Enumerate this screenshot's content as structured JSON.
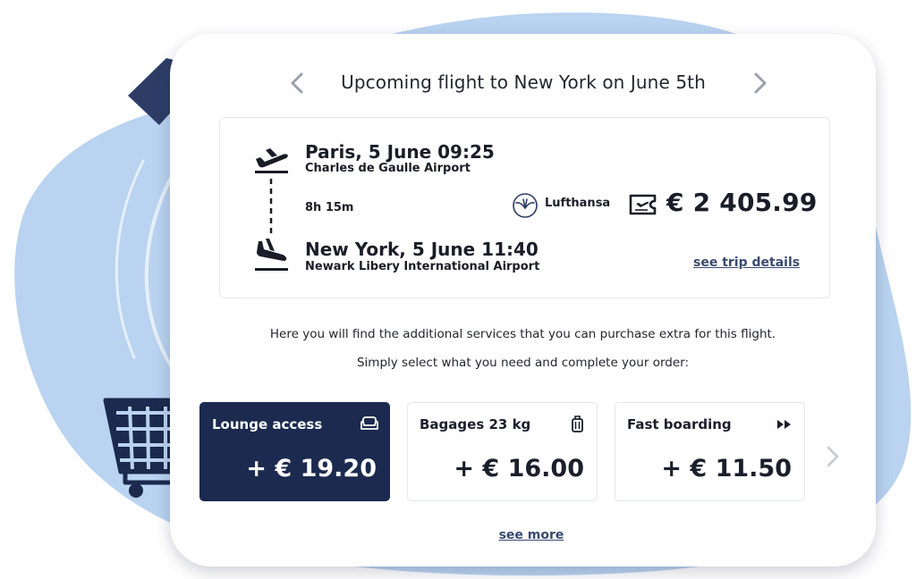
{
  "header": {
    "title": "Upcoming flight to New York on June 5th"
  },
  "flight": {
    "departure": {
      "city_time": "Paris, 5 June 09:25",
      "airport": "Charles de Gaulle Airport"
    },
    "arrival": {
      "city_time": "New York, 5 June 11:40",
      "airport": "Newark Libery International Airport"
    },
    "duration": "8h 15m",
    "airline": "Lufthansa",
    "price": "€ 2 405.99",
    "trip_details_link": "see trip details"
  },
  "info": {
    "line1": "Here you will find the additional services that you can purchase extra for this flight.",
    "line2": "Simply select what you need and complete your order:"
  },
  "services": [
    {
      "label": "Lounge access",
      "price": "+ € 19.20",
      "icon": "sofa-icon",
      "selected": true
    },
    {
      "label": "Bagages 23 kg",
      "price": "+ € 16.00",
      "icon": "suitcase-icon",
      "selected": false
    },
    {
      "label": "Fast boarding",
      "price": "+ € 11.50",
      "icon": "fast-forward-icon",
      "selected": false
    }
  ],
  "footer": {
    "see_more": "see more"
  },
  "colors": {
    "accent_dark": "#1b2a4e",
    "blob": "#b9d3f0",
    "link": "#3a4a70"
  }
}
